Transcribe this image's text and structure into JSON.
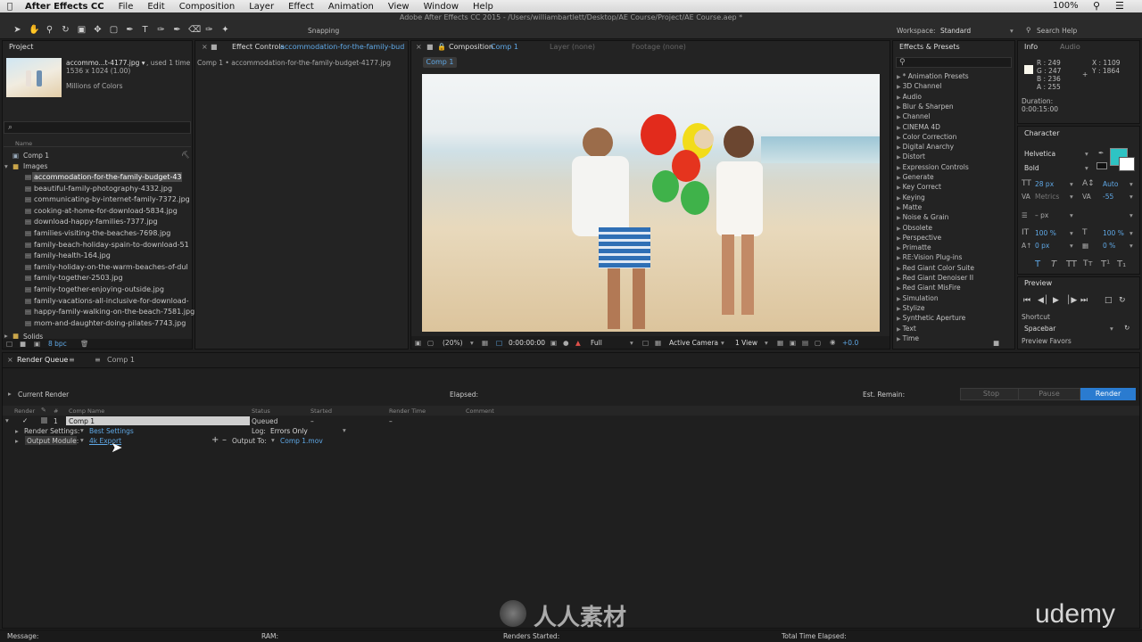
{
  "menu": {
    "app": "After Effects CC",
    "items": [
      "File",
      "Edit",
      "Composition",
      "Layer",
      "Effect",
      "Animation",
      "View",
      "Window",
      "Help"
    ],
    "status": "100%",
    "clock": "□"
  },
  "title": "Adobe After Effects CC 2015 - /Users/williambartlett/Desktop/AE Course/Project/AE Course.aep *",
  "toolbar": {
    "snapping": "Snapping",
    "workspace_label": "Workspace:",
    "workspace_value": "Standard",
    "search_help": "Search Help"
  },
  "project": {
    "tab": "Project",
    "file_name": "accommo...t-4177.jpg ▾",
    "used": ", used 1 time",
    "dims": "1536 x 1024 (1.00)",
    "colors": "Millions of Colors",
    "search_icon": "⌕",
    "col_name": "Name",
    "comp": "Comp 1",
    "folder": "Images",
    "files": [
      "accommodation-for-the-family-budget-43",
      "beautiful-family-photography-4332.jpg",
      "communicating-by-internet-family-7372.jpg",
      "cooking-at-home-for-download-5834.jpg",
      "download-happy-families-7377.jpg",
      "families-visiting-the-beaches-7698.jpg",
      "family-beach-holiday-spain-to-download-51",
      "family-health-164.jpg",
      "family-holiday-on-the-warm-beaches-of-dul",
      "family-together-2503.jpg",
      "family-together-enjoying-outside.jpg",
      "family-vacations-all-inclusive-for-download-",
      "happy-family-walking-on-the-beach-7581.jpg",
      "mom-and-daughter-doing-pilates-7743.jpg"
    ],
    "solids": "Solids",
    "bpc": "8 bpc"
  },
  "effect_controls": {
    "tab": "Effect Controls",
    "tab_file": "accommodation-for-the-family-bud",
    "path": "Comp 1 • accommodation-for-the-family-budget-4177.jpg"
  },
  "composition": {
    "tab": "Composition",
    "tab_name": "Comp 1",
    "layer_tab": "Layer (none)",
    "footage_tab": "Footage (none)",
    "comp_chip": "Comp 1",
    "zoom": "(20%)",
    "timecode": "0:00:00:00",
    "resolution": "Full",
    "camera": "Active Camera",
    "view": "1 View",
    "exposure": "+0.0"
  },
  "effects": {
    "tab": "Effects & Presets",
    "items": [
      "* Animation Presets",
      "3D Channel",
      "Audio",
      "Blur & Sharpen",
      "Channel",
      "CINEMA 4D",
      "Color Correction",
      "Digital Anarchy",
      "Distort",
      "Expression Controls",
      "Generate",
      "Key Correct",
      "Keying",
      "Matte",
      "Noise & Grain",
      "Obsolete",
      "Perspective",
      "Primatte",
      "RE:Vision Plug-ins",
      "Red Giant Color Suite",
      "Red Giant Denoiser II",
      "Red Giant MisFire",
      "Simulation",
      "Stylize",
      "Synthetic Aperture",
      "Text",
      "Time"
    ]
  },
  "info": {
    "tab": "Info",
    "audio_tab": "Audio",
    "r": "R : 249",
    "g": "G : 247",
    "b": "B : 236",
    "a": "A : 255",
    "x": "X : 1109",
    "y": "Y : 1864",
    "duration_label": "Duration:",
    "duration": "0:00:15:00"
  },
  "character": {
    "tab": "Character",
    "font": "Helvetica",
    "style": "Bold",
    "size": "28 px",
    "leading": "Auto",
    "kerning": "Metrics",
    "tracking": "-55",
    "stroke": "– px",
    "vscale": "100 %",
    "hscale": "100 %",
    "baseline": "0 px",
    "tsume": "0 %",
    "fill_color": "#2ec4c4"
  },
  "preview": {
    "tab": "Preview",
    "shortcut_label": "Shortcut",
    "shortcut": "Spacebar",
    "favors": "Preview Favors"
  },
  "render_queue": {
    "tab": "Render Queue",
    "comp_tab": "Comp 1",
    "current_render": "Current Render",
    "elapsed": "Elapsed:",
    "remain": "Est. Remain:",
    "stop": "Stop",
    "pause": "Pause",
    "render": "Render",
    "headers": [
      "Render",
      "#",
      "Comp Name",
      "Status",
      "Started",
      "Render Time",
      "Comment"
    ],
    "row": {
      "num": "1",
      "comp": "Comp 1",
      "status": "Queued",
      "started": "–",
      "time": "–"
    },
    "render_settings_label": "Render Settings:",
    "render_settings": "Best Settings",
    "log_label": "Log:",
    "log": "Errors Only",
    "output_module_label": "Output Module:",
    "output_module": "4k Export",
    "output_to_label": "Output To:",
    "output_to": "Comp 1.mov"
  },
  "footer": {
    "message": "Message:",
    "ram": "RAM:",
    "renders_started": "Renders Started:",
    "total_elapsed": "Total Time Elapsed:"
  },
  "watermark": {
    "brand": "udemy",
    "site": "人人素材"
  }
}
